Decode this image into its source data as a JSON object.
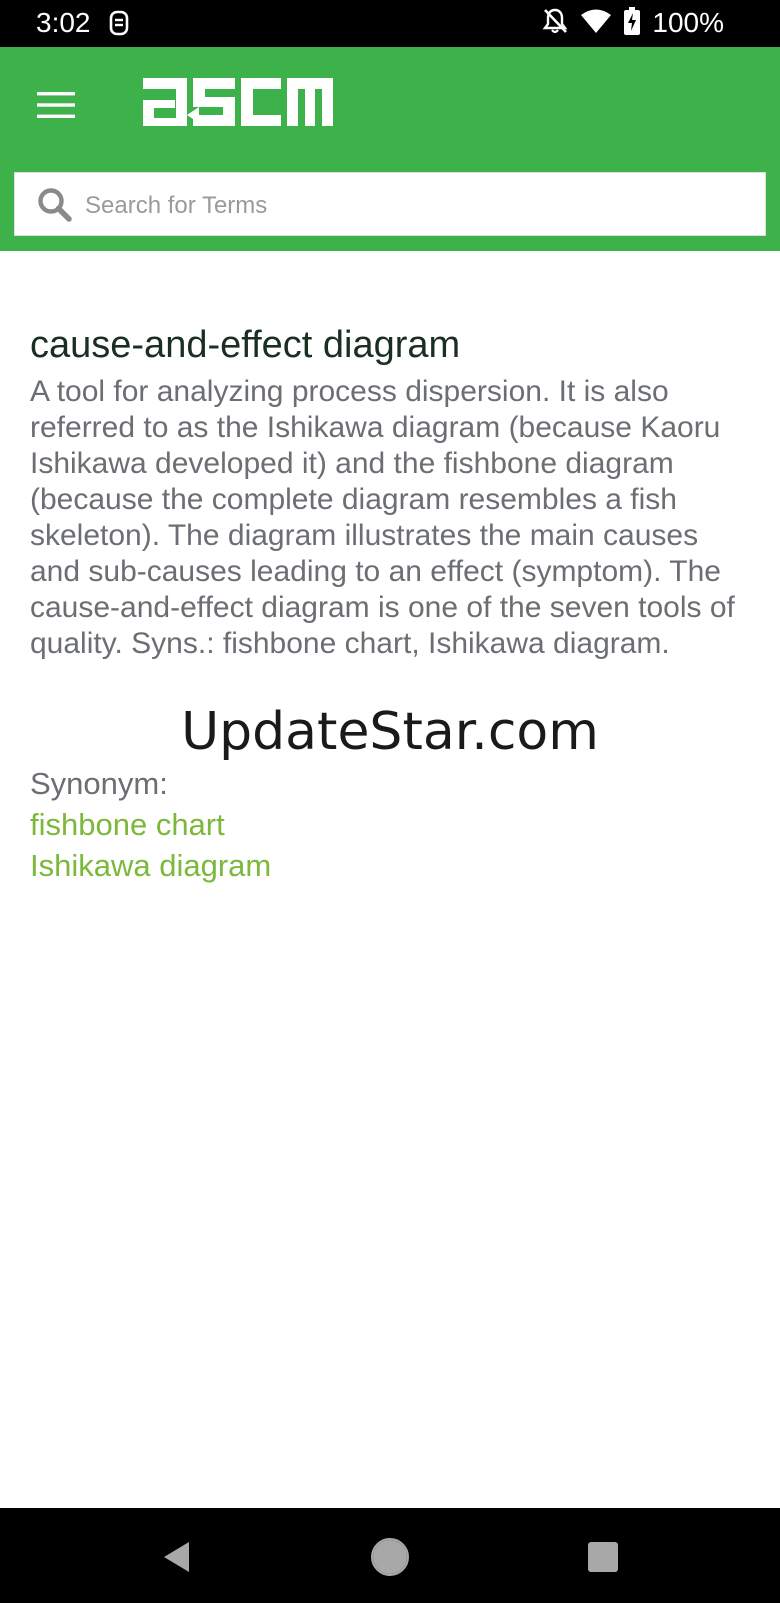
{
  "status_bar": {
    "time": "3:02",
    "battery": "100%",
    "icons": [
      "fitbit-icon",
      "bell-off-icon",
      "wifi-icon",
      "battery-charging-icon"
    ]
  },
  "header": {
    "logo_text": "ascm",
    "menu_icon": "hamburger-menu-icon",
    "background_color": "#3db24b"
  },
  "search": {
    "placeholder": "Search for Terms",
    "value": ""
  },
  "term": {
    "title": "cause-and-effect diagram",
    "definition": "A tool for analyzing process dispersion. It is also referred to as the Ishikawa diagram (because Kaoru Ishikawa developed it) and the fishbone diagram (because the complete diagram resembles a fish skeleton). The diagram illustrates the main causes and sub-causes leading to an effect (symptom). The cause-and-effect diagram is one of the seven tools of quality. Syns.: fishbone chart, Ishikawa diagram."
  },
  "watermark": "UpdateStar.com",
  "synonyms": {
    "label": "Synonym:",
    "items": [
      "fishbone chart",
      "Ishikawa diagram"
    ],
    "link_color": "#7cb83b"
  },
  "nav_bar": {
    "buttons": [
      "back-icon",
      "home-icon",
      "recents-icon"
    ]
  }
}
